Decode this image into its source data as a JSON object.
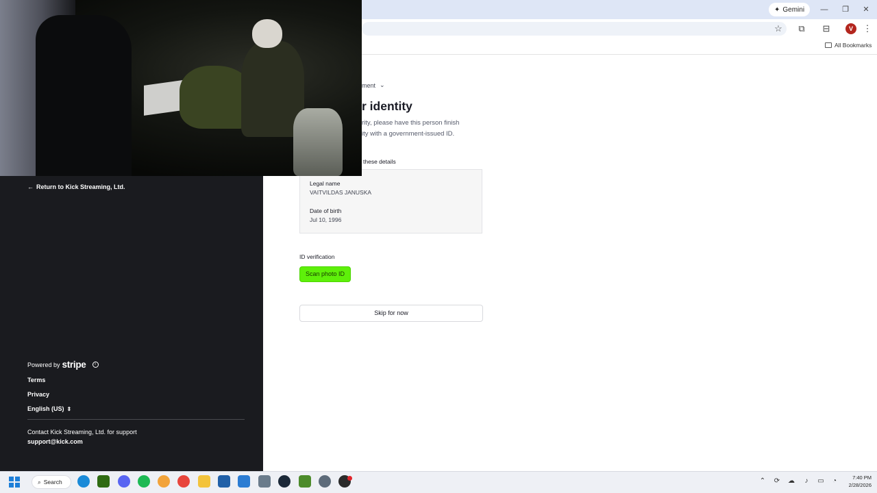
{
  "browser": {
    "gemini_label": "Gemini",
    "avatar_letter": "V",
    "all_bookmarks": "All Bookmarks"
  },
  "stripe_panel": {
    "return_link": "Return to Kick Streaming, Ltd.",
    "powered_by": "Powered by",
    "stripe_brand": "stripe",
    "terms": "Terms",
    "privacy": "Privacy",
    "language": "English (US)",
    "contact_text": "Contact Kick Streaming, Ltd. for support",
    "contact_email": "support@kick.com"
  },
  "main": {
    "crumb": "ment",
    "heading": "r identity",
    "intro_line1": "rity, please have this person finish",
    "intro_line2": "ity with a government-issued ID.",
    "confirm_label": "these details",
    "legal_name_label": "Legal name",
    "legal_name_value": "VAITVILDAS JANUSKA",
    "dob_label": "Date of birth",
    "dob_value": "Jul 10, 1996",
    "id_verification_label": "ID verification",
    "scan_button": "Scan photo ID",
    "skip_button": "Skip for now"
  },
  "taskbar": {
    "search_label": "Search",
    "time": "7:40 PM",
    "date": "2/28/2026"
  },
  "colors": {
    "scan_button_bg": "#5ef00a",
    "left_panel_bg": "#1a1b1f",
    "titlebar_bg": "#dee6f6"
  }
}
